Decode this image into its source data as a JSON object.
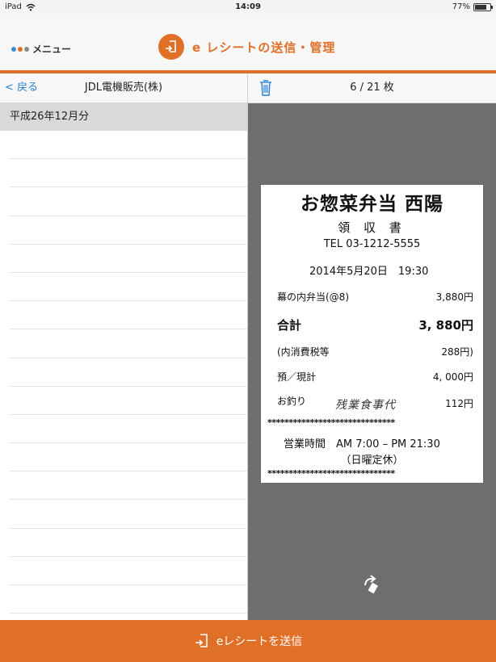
{
  "status_bar": {
    "device": "iPad",
    "time": "14:09",
    "battery": "77%",
    "battery_level": 0.77
  },
  "header": {
    "menu_label": "メニュー",
    "title": "e レシートの送信・管理",
    "menu_dot_colors": [
      "#3b8fd8",
      "#e07028",
      "#8a8a8a"
    ],
    "accent": "#e07028"
  },
  "left_nav": {
    "back_label": "< 戻る",
    "title": "JDL電機販売(株)"
  },
  "list": {
    "section_header": "平成26年12月分"
  },
  "right_nav": {
    "page_counter": "6 / 21 枚",
    "link_color": "#2a7fd4"
  },
  "receipt": {
    "shop_name": "お惣菜弁当 西陽",
    "kind": "領 収 書",
    "tel": "TEL 03-1212-5555",
    "date": "2014年5月20日　19:30",
    "item_name": "幕の内弁当(@8)",
    "item_price": "3,880円",
    "total_label": "合計",
    "total_value": "3, 880円",
    "tax_label": "(内消費税等",
    "tax_value": "288円)",
    "paid_label": "預／現計",
    "paid_value": "4, 000円",
    "change_label": "お釣り",
    "change_value": "112円",
    "handwritten_note": "残業食事代",
    "stars": "******************************",
    "hours": "営業時間　AM 7:00 – PM 21:30",
    "closed": "（日曜定休）"
  },
  "footer": {
    "send_label": "eレシートを送信"
  },
  "icons": {
    "wifi": "wifi-icon",
    "trash": "trash-icon",
    "rotate": "rotate-icon",
    "receipt_badge": "receipt-icon",
    "send": "receipt-send-icon"
  }
}
